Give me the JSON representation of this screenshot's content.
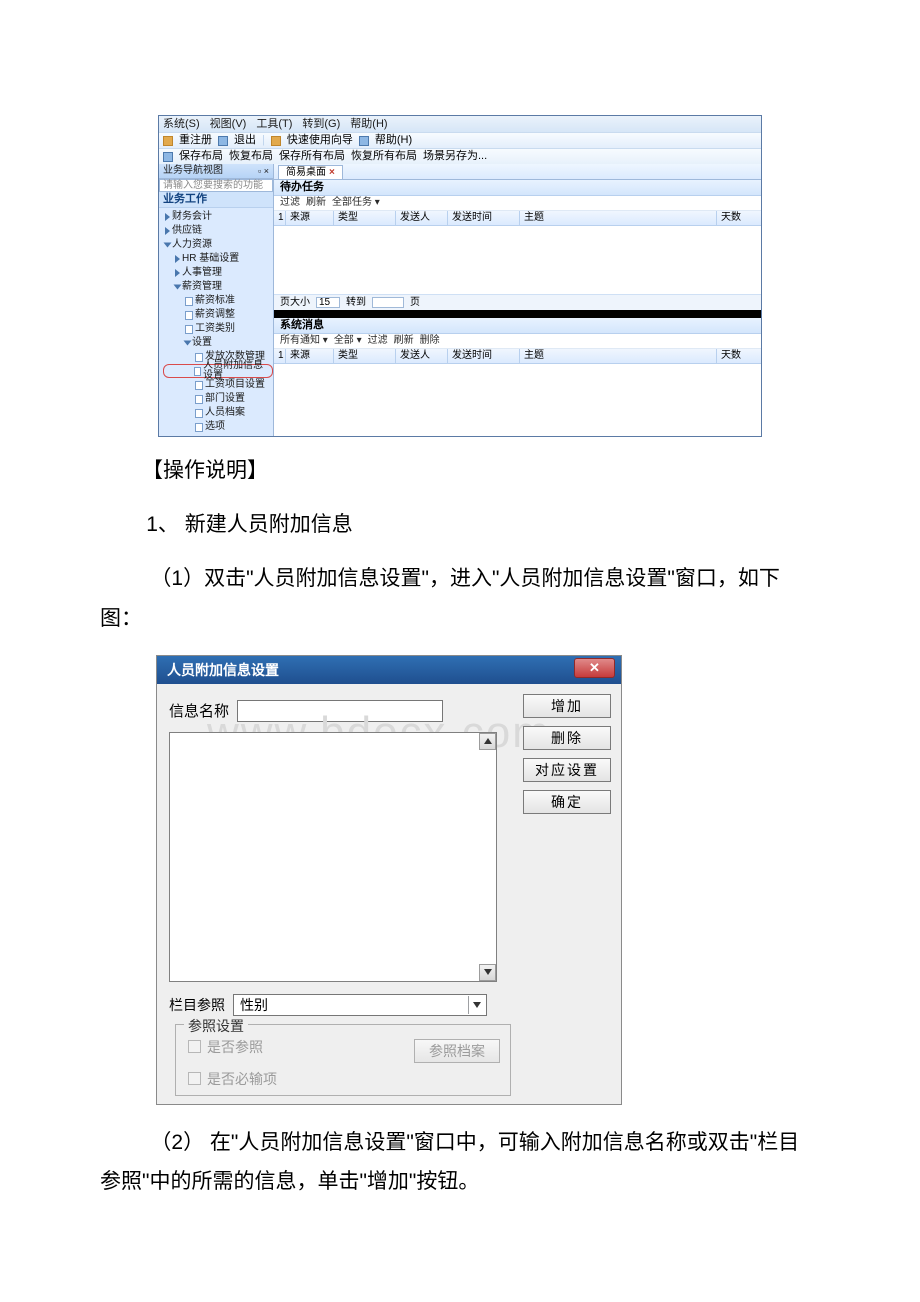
{
  "erp": {
    "menus": [
      "系统(S)",
      "视图(V)",
      "工具(T)",
      "转到(G)",
      "帮助(H)"
    ],
    "toolbar1": [
      "重注册",
      "退出",
      "快速使用向导",
      "帮助(H)"
    ],
    "toolbar2": [
      "保存布局",
      "恢复布局",
      "保存所有布局",
      "恢复所有布局",
      "场景另存为..."
    ],
    "side": {
      "nav_title": "业务导航视图",
      "search_placeholder": "请输入您要搜索的功能",
      "section": "业务工作",
      "tree": {
        "n1": "财务会计",
        "n2": "供应链",
        "n3": "人力资源",
        "n3_1": "HR 基础设置",
        "n3_2": "人事管理",
        "n3_3": "薪资管理",
        "n3_3_1": "薪资标准",
        "n3_3_2": "薪资调整",
        "n3_3_3": "工资类别",
        "n3_3_4": "设置",
        "n3_3_4_1": "发放次数管理",
        "n3_3_4_2": "人员附加信息设置",
        "n3_3_4_3": "工资项目设置",
        "n3_3_4_4": "部门设置",
        "n3_3_4_5": "人员档案",
        "n3_3_4_6": "选项"
      }
    },
    "main": {
      "tab": "简易桌面",
      "panel1": {
        "title": "待办任务",
        "filters": [
          "过滤",
          "刷新",
          "全部任务 ▾"
        ],
        "cols": {
          "rn": "1",
          "src": "来源",
          "type": "类型",
          "sender": "发送人",
          "time": "发送时间",
          "subj": "主题",
          "days": "天数"
        },
        "pager": {
          "label": "页大小",
          "size": "15",
          "goto": "转到",
          "unit": "页"
        }
      },
      "panel2": {
        "title": "系统消息",
        "filters": [
          "所有通知 ▾",
          "全部 ▾",
          "过滤",
          "刷新",
          "删除"
        ],
        "cols": {
          "rn": "1",
          "src": "来源",
          "type": "类型",
          "sender": "发送人",
          "time": "发送时间",
          "subj": "主题",
          "days": "天数"
        }
      }
    }
  },
  "text": {
    "t1": "【操作说明】",
    "t2": "1、 新建人员附加信息",
    "t3": "（1）双击\"人员附加信息设置\"，进入\"人员附加信息设置\"窗口，如下图：",
    "t4": "（2） 在\"人员附加信息设置\"窗口中，可输入附加信息名称或双击\"栏目参照\"中的所需的信息，单击\"增加\"按钮。"
  },
  "dlg": {
    "title": "人员附加信息设置",
    "watermark": "www.bdocx.com",
    "label_name": "信息名称",
    "btn_add": "增加",
    "btn_del": "删除",
    "btn_map": "对应设置",
    "btn_ok": "确定",
    "label_ref": "栏目参照",
    "ref_value": "性别",
    "fieldset_title": "参照设置",
    "chk1": "是否参照",
    "chk2": "是否必输项",
    "btn_ref_archive": "参照档案"
  }
}
